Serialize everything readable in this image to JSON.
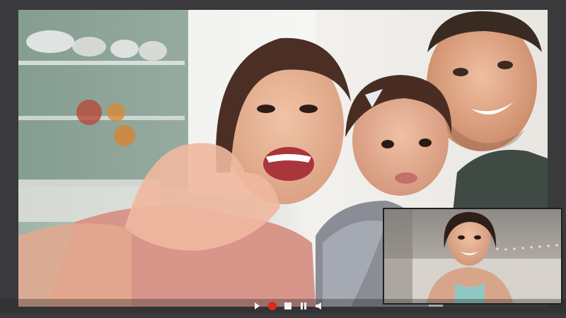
{
  "colors": {
    "window_bg": "#3a3a3c",
    "record_red": "#e0261e",
    "control_white": "#f2f2f2"
  },
  "controls": [
    {
      "name": "play-button",
      "icon": "play-icon"
    },
    {
      "name": "record-button",
      "icon": "record-icon"
    },
    {
      "name": "stop-button",
      "icon": "stop-icon"
    },
    {
      "name": "pause-button",
      "icon": "pause-icon"
    },
    {
      "name": "volume-button",
      "icon": "volume-icon"
    }
  ]
}
